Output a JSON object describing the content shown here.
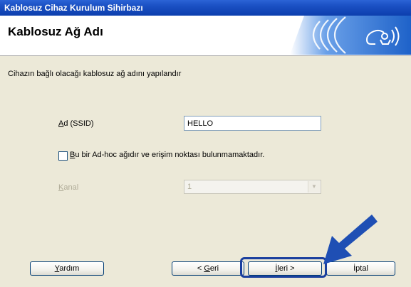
{
  "window": {
    "title": "Kablosuz Cihaz Kurulum Sihirbazı"
  },
  "header": {
    "title": "Kablosuz Ağ Adı"
  },
  "instruction": "Cihazın bağlı olacağı kablosuz ağ adını yapılandır",
  "ssid": {
    "label_mnemonic": "A",
    "label_rest": "d (SSID)",
    "value": "HELLO"
  },
  "adhoc": {
    "label_mnemonic": "B",
    "label_rest": "u bir Ad-hoc ağıdır ve erişim noktası bulunmamaktadır.",
    "checked": false
  },
  "channel": {
    "label_mnemonic": "K",
    "label_rest": "anal",
    "value": "1",
    "enabled": false
  },
  "buttons": {
    "help": {
      "mnemonic": "Y",
      "rest": "ardım"
    },
    "back": {
      "prefix": "< ",
      "mnemonic": "G",
      "rest": "eri"
    },
    "next": {
      "mnemonic": "İ",
      "rest": "leri >"
    },
    "cancel": {
      "label": "İptal"
    }
  },
  "colors": {
    "titlebar": "#1a4fc2",
    "dialog_bg": "#ece9d8",
    "highlight": "#1a3f9e",
    "arrow": "#1f4fb4"
  },
  "icons": {
    "logo": "wireless-signal-icon",
    "arrow": "pointer-arrow-icon"
  }
}
